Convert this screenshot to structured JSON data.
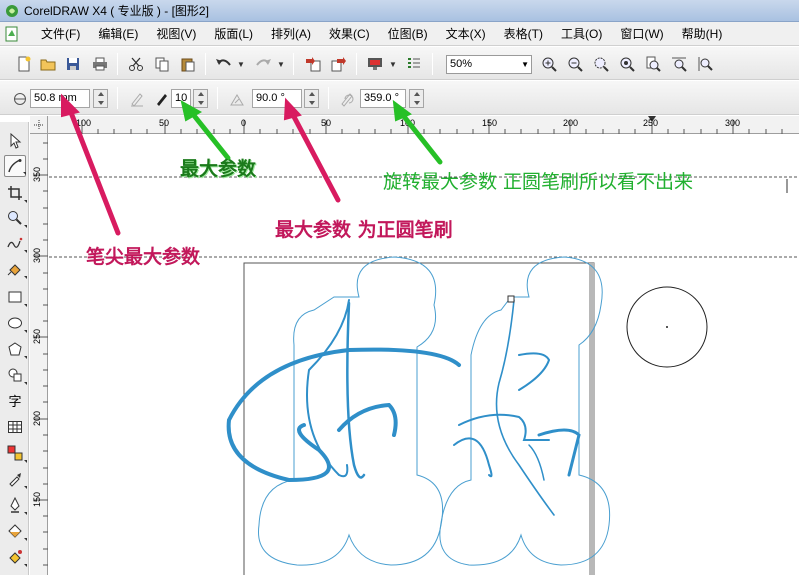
{
  "window": {
    "title": "CorelDRAW X4 ( 专业版 ) - [图形2]"
  },
  "menubar": {
    "items": [
      "文件(F)",
      "编辑(E)",
      "视图(V)",
      "版面(L)",
      "排列(A)",
      "效果(C)",
      "位图(B)",
      "文本(X)",
      "表格(T)",
      "工具(O)",
      "窗口(W)",
      "帮助(H)"
    ]
  },
  "toolbar": {
    "zoom_value": "50%"
  },
  "property_bar": {
    "nib_size": "50.8 mm",
    "pen_size": "10",
    "angle": "90.0 °",
    "rotation": "359.0 °"
  },
  "rulers": {
    "horizontal_ticks": [
      "100",
      "50",
      "0",
      "50",
      "100",
      "150",
      "200",
      "250",
      "300"
    ],
    "vertical_ticks": [
      "350",
      "300",
      "250",
      "200",
      "150"
    ]
  },
  "annotations": {
    "nib_max": "笔尖最大参数",
    "max_param": "最大参数",
    "max_param_round": "最大参数 为正圆笔刷",
    "rotation_max": "旋转最大参数 正圆笔刷所以看不出来"
  },
  "colors": {
    "annotation_pink": "#c2185b",
    "annotation_green": "#1faa2e",
    "stroke_blue": "#2f8fc9"
  }
}
